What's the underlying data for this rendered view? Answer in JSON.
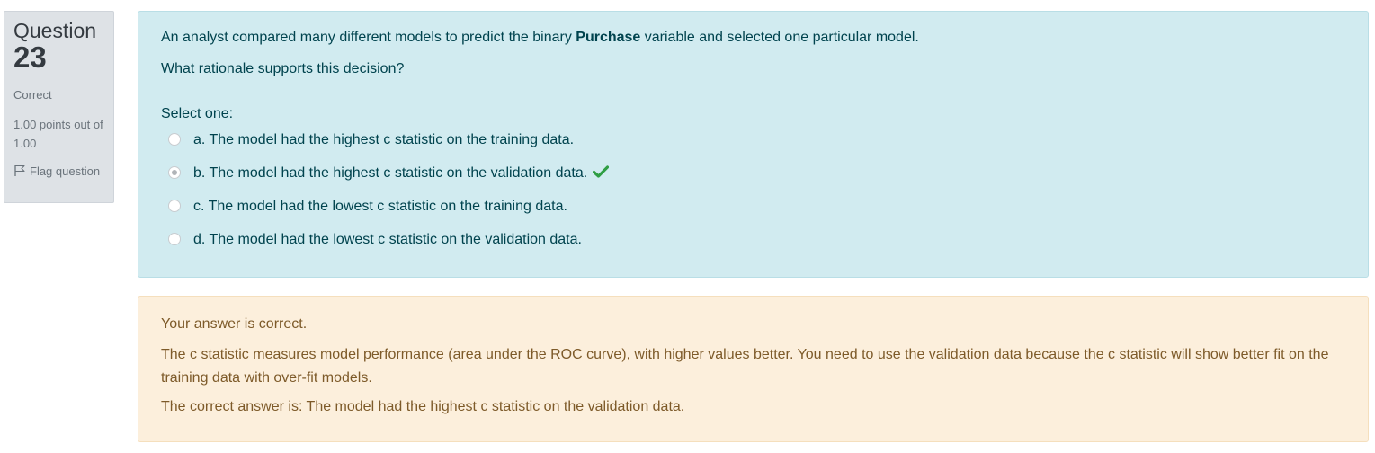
{
  "info": {
    "question_label": "Question",
    "question_number": "23",
    "state": "Correct",
    "grade": "1.00 points out of 1.00",
    "flag": "Flag question"
  },
  "question": {
    "text_before_bold": "An analyst compared many different models to predict the binary ",
    "bold_term": "Purchase",
    "text_after_bold": " variable and selected one particular model.",
    "sub_text": "What rationale supports this decision?",
    "prompt": "Select one:",
    "options": [
      {
        "label": "a. The model had the highest c statistic on the training data.",
        "checked": false
      },
      {
        "label": "b. The model had the highest c statistic on the validation data.",
        "checked": true,
        "correct_mark": "check-icon"
      },
      {
        "label": "c. The model had the lowest c statistic on the training data.",
        "checked": false
      },
      {
        "label": "d. The model had the lowest c statistic on the validation data.",
        "checked": false
      }
    ]
  },
  "feedback": {
    "result": "Your answer is correct.",
    "general": "The c statistic measures model performance (area under the ROC curve), with higher values better. You need to use the validation data because the c statistic will show better fit on the training data with over-fit models.",
    "right_answer": "The correct answer is: The model had the highest c statistic on the validation data."
  },
  "colors": {
    "question_bg": "#d1ebf0",
    "question_text": "#00434e",
    "feedback_bg": "#fcefdc",
    "feedback_text": "#7d5a29",
    "correct_green": "#2f9e44",
    "info_bg": "#dee2e6"
  }
}
